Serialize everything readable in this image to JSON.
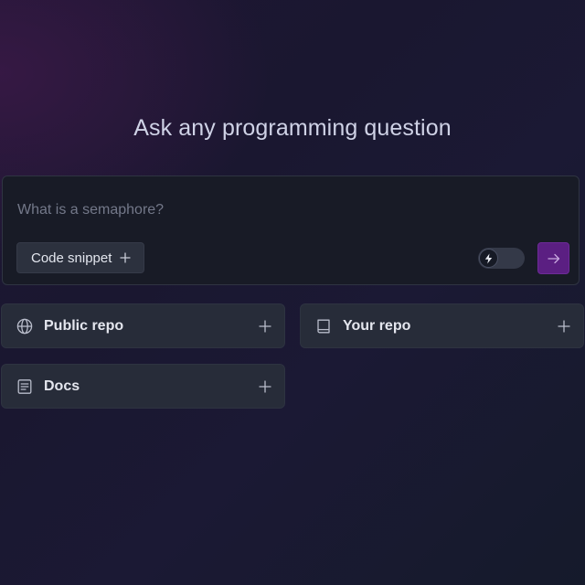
{
  "heading": "Ask any programming question",
  "ask": {
    "placeholder": "What is a semaphore?",
    "value": "",
    "snippet_label": "Code snippet",
    "toggle_on": false,
    "toggle_icon": "lightning-bolt-icon",
    "send_icon": "arrow-right-icon"
  },
  "sources": [
    {
      "label": "Public repo",
      "icon": "globe-icon"
    },
    {
      "label": "Your repo",
      "icon": "book-icon"
    },
    {
      "label": "Docs",
      "icon": "document-icon"
    }
  ],
  "colors": {
    "accent": "#5b1f82",
    "card_bg": "#272c39",
    "box_bg": "#181b26"
  }
}
